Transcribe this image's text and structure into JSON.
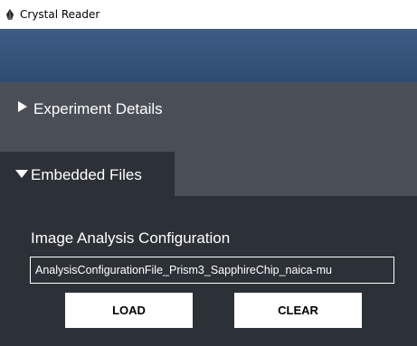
{
  "window": {
    "title": "Crystal Reader",
    "icon": "crystal-app-icon"
  },
  "sections": {
    "experiment_details": {
      "label": "Experiment Details",
      "expanded": false
    },
    "embedded_files": {
      "label": "Embedded Files",
      "expanded": true
    }
  },
  "image_analysis": {
    "label": "Image Analysis Configuration",
    "file_value": "AnalysisConfigurationFile_Prism3_SapphireChip_naica-mu",
    "load_label": "LOAD",
    "clear_label": "CLEAR"
  },
  "colors": {
    "header_blue": "#34527a",
    "panel_dark": "#2c3037",
    "panel_mid": "#4a4f57"
  }
}
